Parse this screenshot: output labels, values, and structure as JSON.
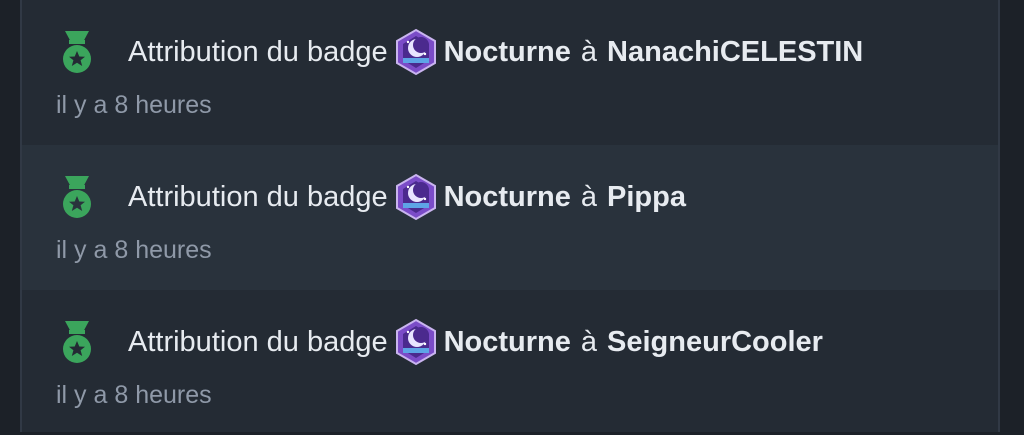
{
  "feed": {
    "items": [
      {
        "action": "Attribution du badge",
        "badge_name": "Nocturne",
        "preposition": "à",
        "recipient": "NanachiCELESTIN",
        "time": "il y a 8 heures",
        "icon": "medal-icon",
        "badge_icon": "nocturne-badge-icon"
      },
      {
        "action": "Attribution du badge",
        "badge_name": "Nocturne",
        "preposition": "à",
        "recipient": "Pippa",
        "time": "il y a 8 heures",
        "icon": "medal-icon",
        "badge_icon": "nocturne-badge-icon"
      },
      {
        "action": "Attribution du badge",
        "badge_name": "Nocturne",
        "preposition": "à",
        "recipient": "SeigneurCooler",
        "time": "il y a 8 heures",
        "icon": "medal-icon",
        "badge_icon": "nocturne-badge-icon"
      }
    ]
  },
  "colors": {
    "page_background": "#1c2128",
    "panel_background": "#242b34",
    "alt_row_background": "#29323c",
    "text": "#e7ebf0",
    "muted_text": "#8f99a8",
    "medal_green": "#3ba55c",
    "badge_purple": "#7b4cc8"
  }
}
